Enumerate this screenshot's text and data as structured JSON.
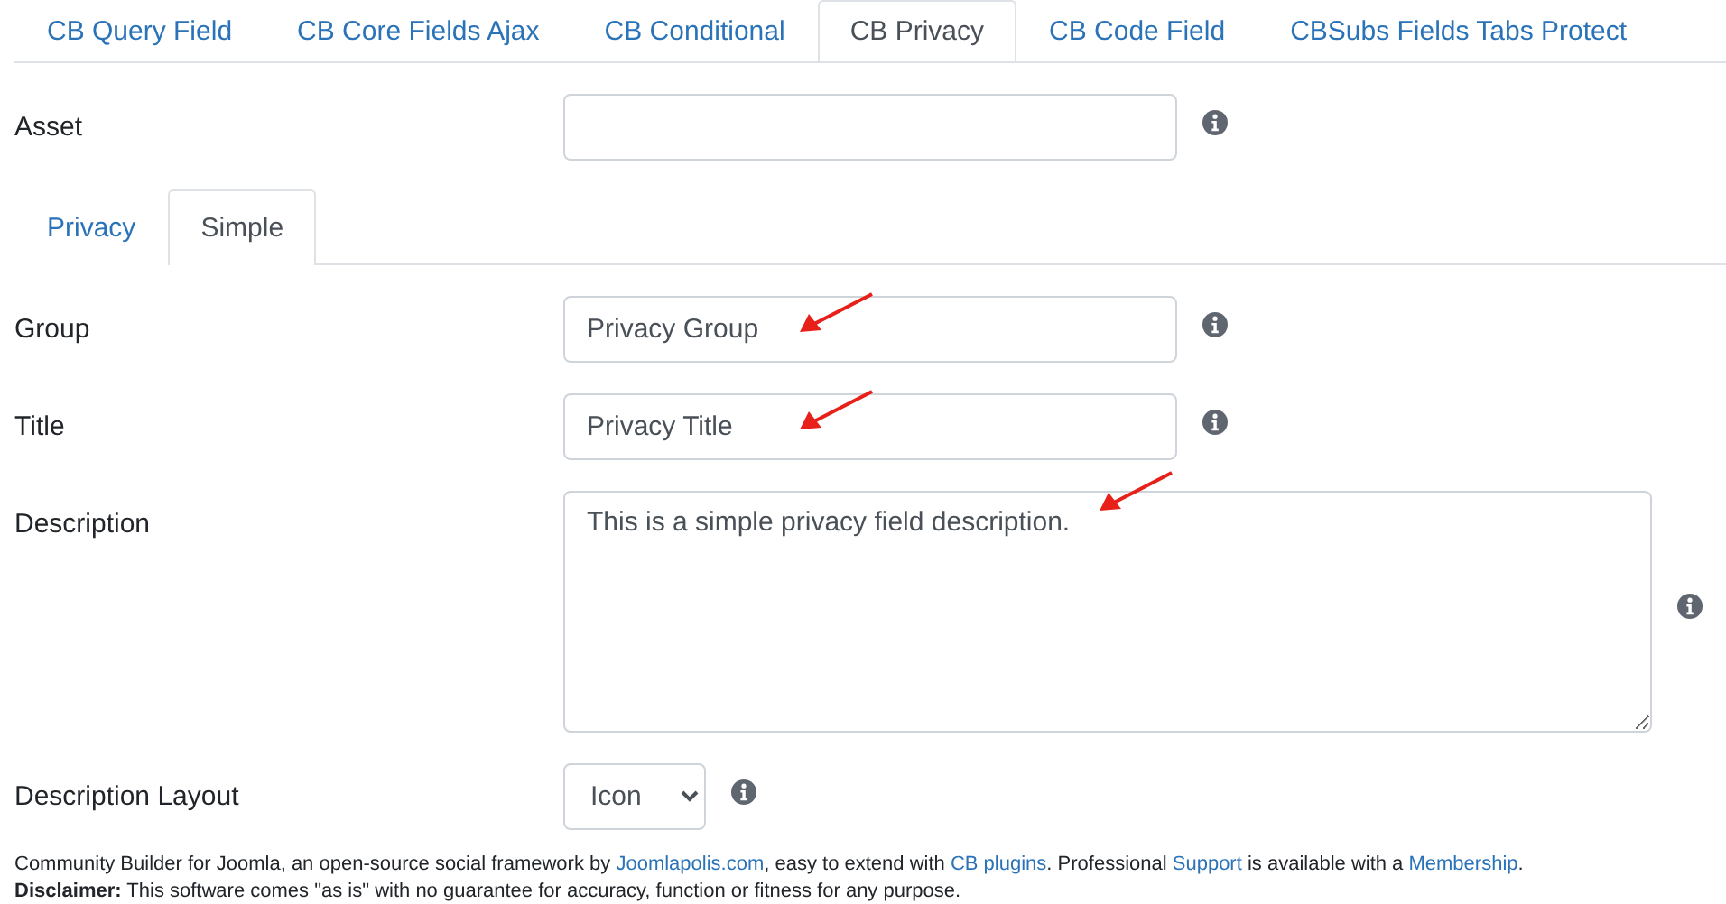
{
  "tabs": [
    {
      "label": "CB Query Field",
      "selected": false
    },
    {
      "label": "CB Core Fields Ajax",
      "selected": false
    },
    {
      "label": "CB Conditional",
      "selected": false
    },
    {
      "label": "CB Privacy",
      "selected": true
    },
    {
      "label": "CB Code Field",
      "selected": false
    },
    {
      "label": "CBSubs Fields Tabs Protect",
      "selected": false
    }
  ],
  "asset": {
    "label": "Asset",
    "kind": "input",
    "marked": false
  },
  "subtabs": [
    {
      "label": "Privacy",
      "selected": false
    },
    {
      "label": "Simple",
      "selected": true
    }
  ],
  "fields": [
    {
      "label": "Group",
      "kind": "input",
      "value": "Privacy Group",
      "marked": true
    },
    {
      "label": "Title",
      "kind": "input",
      "value": "Privacy Title",
      "marked": true
    },
    {
      "label": "Description",
      "kind": "textarea",
      "value": "This is a simple privacy field description.",
      "marked": true
    },
    {
      "label": "Description Layout",
      "kind": "select",
      "value": "Icon",
      "marked": false
    }
  ],
  "footer": {
    "parts": [
      {
        "kind": "text",
        "text": "Community Builder for Joomla, an open-source social framework by "
      },
      {
        "kind": "link",
        "text": "Joomlapolis.com"
      },
      {
        "kind": "text",
        "text": ", easy to extend with "
      },
      {
        "kind": "link",
        "text": "CB plugins"
      },
      {
        "kind": "text",
        "text": ". Professional "
      },
      {
        "kind": "link",
        "text": "Support"
      },
      {
        "kind": "text",
        "text": " is available with a "
      },
      {
        "kind": "link",
        "text": "Membership"
      },
      {
        "kind": "text",
        "text": "."
      }
    ],
    "disclaimer": "**Disclaimer:** This software comes \"as is\" with no guarantee for accuracy, function or fitness for any purpose."
  }
}
